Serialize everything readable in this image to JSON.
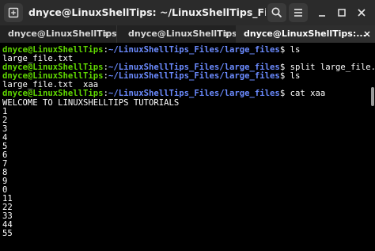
{
  "window": {
    "title": "dnyce@LinuxShellTips: ~/LinuxShellTips_Files/large_files"
  },
  "tabs": [
    {
      "label": "dnyce@LinuxShellTips:..."
    },
    {
      "label": "dnyce@LinuxShellTips:..."
    },
    {
      "label": "dnyce@LinuxShellTips:..."
    }
  ],
  "icons": {
    "new_tab": "new-tab-icon",
    "search": "search-icon",
    "menu": "hamburger-menu-icon",
    "minimize": "minimize-icon",
    "maximize": "maximize-icon",
    "close": "close-icon"
  },
  "colors": {
    "prompt_user": "#5fd700",
    "prompt_path": "#6b8bff",
    "text": "#ffffff",
    "background": "#000000"
  },
  "terminal": {
    "prompt": {
      "user": "dnyce@LinuxShellTips",
      "sep": ":",
      "path": "~/LinuxShellTips_Files/large_files",
      "symbol": "$"
    },
    "commands": [
      " ls",
      " split large_file.txt",
      " ls",
      " cat xaa"
    ],
    "outputs": {
      "ls1": "large_file.txt",
      "ls2": "large_file.txt  xaa",
      "cat": [
        "WELCOME TO LINUXSHELLTIPS TUTORIALS",
        "1",
        "2",
        "3",
        "4",
        "5",
        "6",
        "7",
        "8",
        "9",
        "0",
        "11",
        "22",
        "33",
        "44",
        "55"
      ]
    }
  }
}
